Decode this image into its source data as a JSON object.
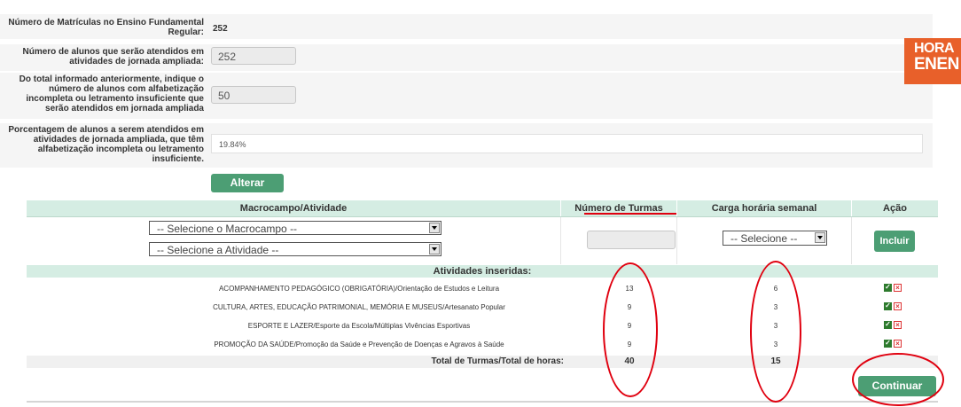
{
  "form": {
    "matriculas_label": "Número de Matrículas no Ensino Fundamental Regular:",
    "matriculas_value": "252",
    "alunos_label": "Número de alunos que serão atendidos em atividades de jornada ampliada:",
    "alunos_value": "252",
    "alfabetizacao_label": "Do total informado anteriormente, indique o número de alunos com alfabetização incompleta ou letramento insuficiente que serão atendidos em jornada ampliada",
    "alfabetizacao_value": "50",
    "porcentagem_label": "Porcentagem de alunos a serem atendidos em atividades de jornada ampliada, que têm alfabetização incompleta ou letramento insuficiente.",
    "porcentagem_value": "19.84%",
    "alterar_label": "Alterar"
  },
  "logo": {
    "line1": "HORA",
    "line2": "ENEN"
  },
  "table": {
    "headers": {
      "macrocampo": "Macrocampo/Atividade",
      "turmas": "Número de Turmas",
      "carga": "Carga horária semanal",
      "acao": "Ação"
    },
    "macrocampo_select": "-- Selecione o Macrocampo --",
    "atividade_select": "-- Selecione a Atividade --",
    "carga_select": "-- Selecione --",
    "incluir_label": "Incluir",
    "inseridas_title": "Atividades inseridas:",
    "rows": [
      {
        "atividade": "ACOMPANHAMENTO PEDAGÓGICO (OBRIGATÓRIA)/Orientação de Estudos e Leitura",
        "turmas": "13",
        "horas": "6"
      },
      {
        "atividade": "CULTURA, ARTES, EDUCAÇÃO PATRIMONIAL, MEMÓRIA E MUSEUS/Artesanato Popular",
        "turmas": "9",
        "horas": "3"
      },
      {
        "atividade": "ESPORTE E LAZER/Esporte da Escola/Múltiplas Vivências Esportivas",
        "turmas": "9",
        "horas": "3"
      },
      {
        "atividade": "PROMOÇÃO DA SAÚDE/Promoção da Saúde e Prevenção de Doenças e Agravos à Saúde",
        "turmas": "9",
        "horas": "3"
      }
    ],
    "total_label": "Total de Turmas/Total de horas:",
    "total_turmas": "40",
    "total_horas": "15",
    "continuar_label": "Continuar"
  },
  "colors": {
    "accent": "#4c9e74",
    "header_bg": "#d5ede3",
    "annotation": "#e0000f",
    "logo": "#e8602a"
  }
}
